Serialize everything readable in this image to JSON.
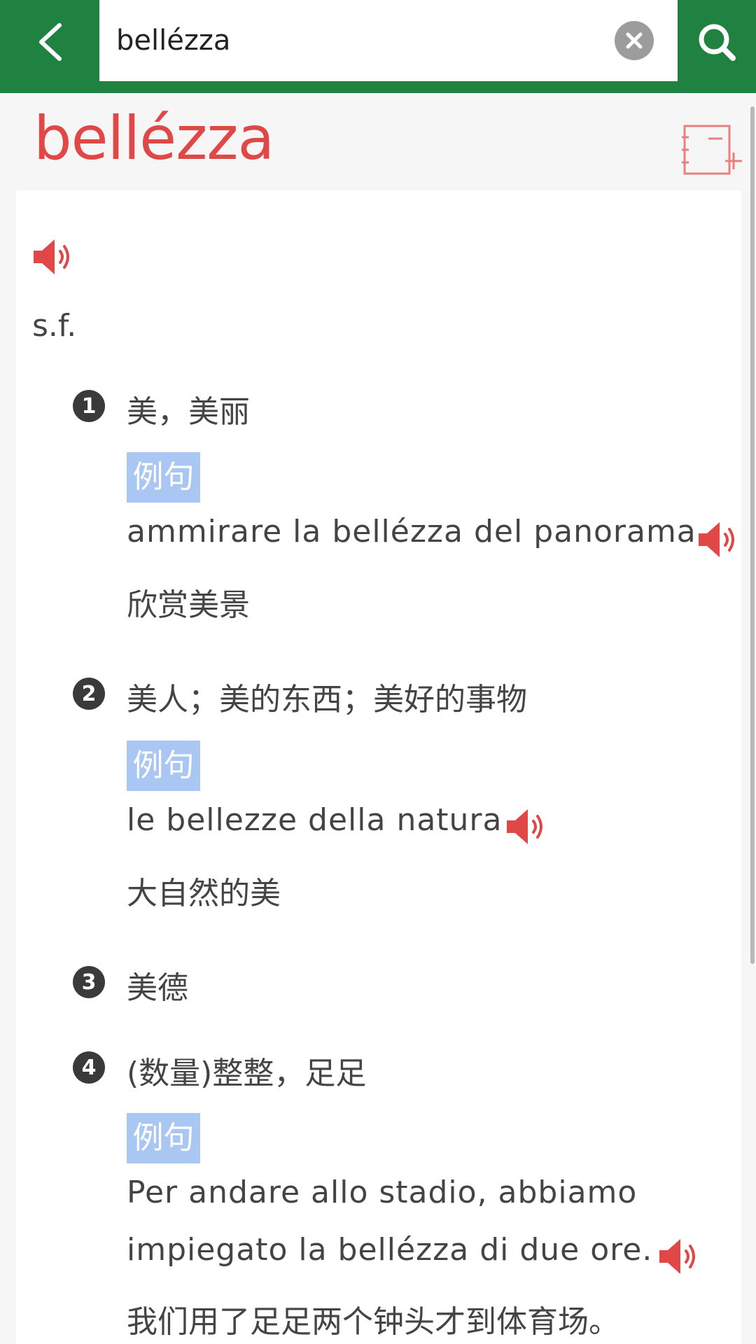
{
  "search": {
    "query": "bellézza"
  },
  "entry": {
    "headword": "bellézza",
    "pos": "s.f.",
    "senses": [
      {
        "number": "1",
        "definition": "美，美丽",
        "example_tag": "例句",
        "example": "ammirare la bellézza del panorama",
        "translation": "欣赏美景"
      },
      {
        "number": "2",
        "definition": "美人；美的东西；美好的事物",
        "example_tag": "例句",
        "example": "le bellezze della natura",
        "translation": "大自然的美"
      },
      {
        "number": "3",
        "definition": "美德"
      },
      {
        "number": "4",
        "definition": "(数量)整整，足足",
        "example_tag": "例句",
        "example_line1": "Per andare allo stadio, abbiamo",
        "example_line2": "impiegato la bellézza di due ore.",
        "translation": "我们用了足足两个钟头才到体育场。"
      }
    ]
  },
  "icons": {
    "back": "chevron-left-icon",
    "clear": "close-circle-icon",
    "search": "search-icon",
    "wordbook": "add-to-wordbook-icon",
    "speaker": "speaker-icon"
  },
  "colors": {
    "topbar": "#1f8241",
    "headword": "#e04848",
    "tag_bg": "#a9c7f2",
    "speaker": "#e04848"
  }
}
